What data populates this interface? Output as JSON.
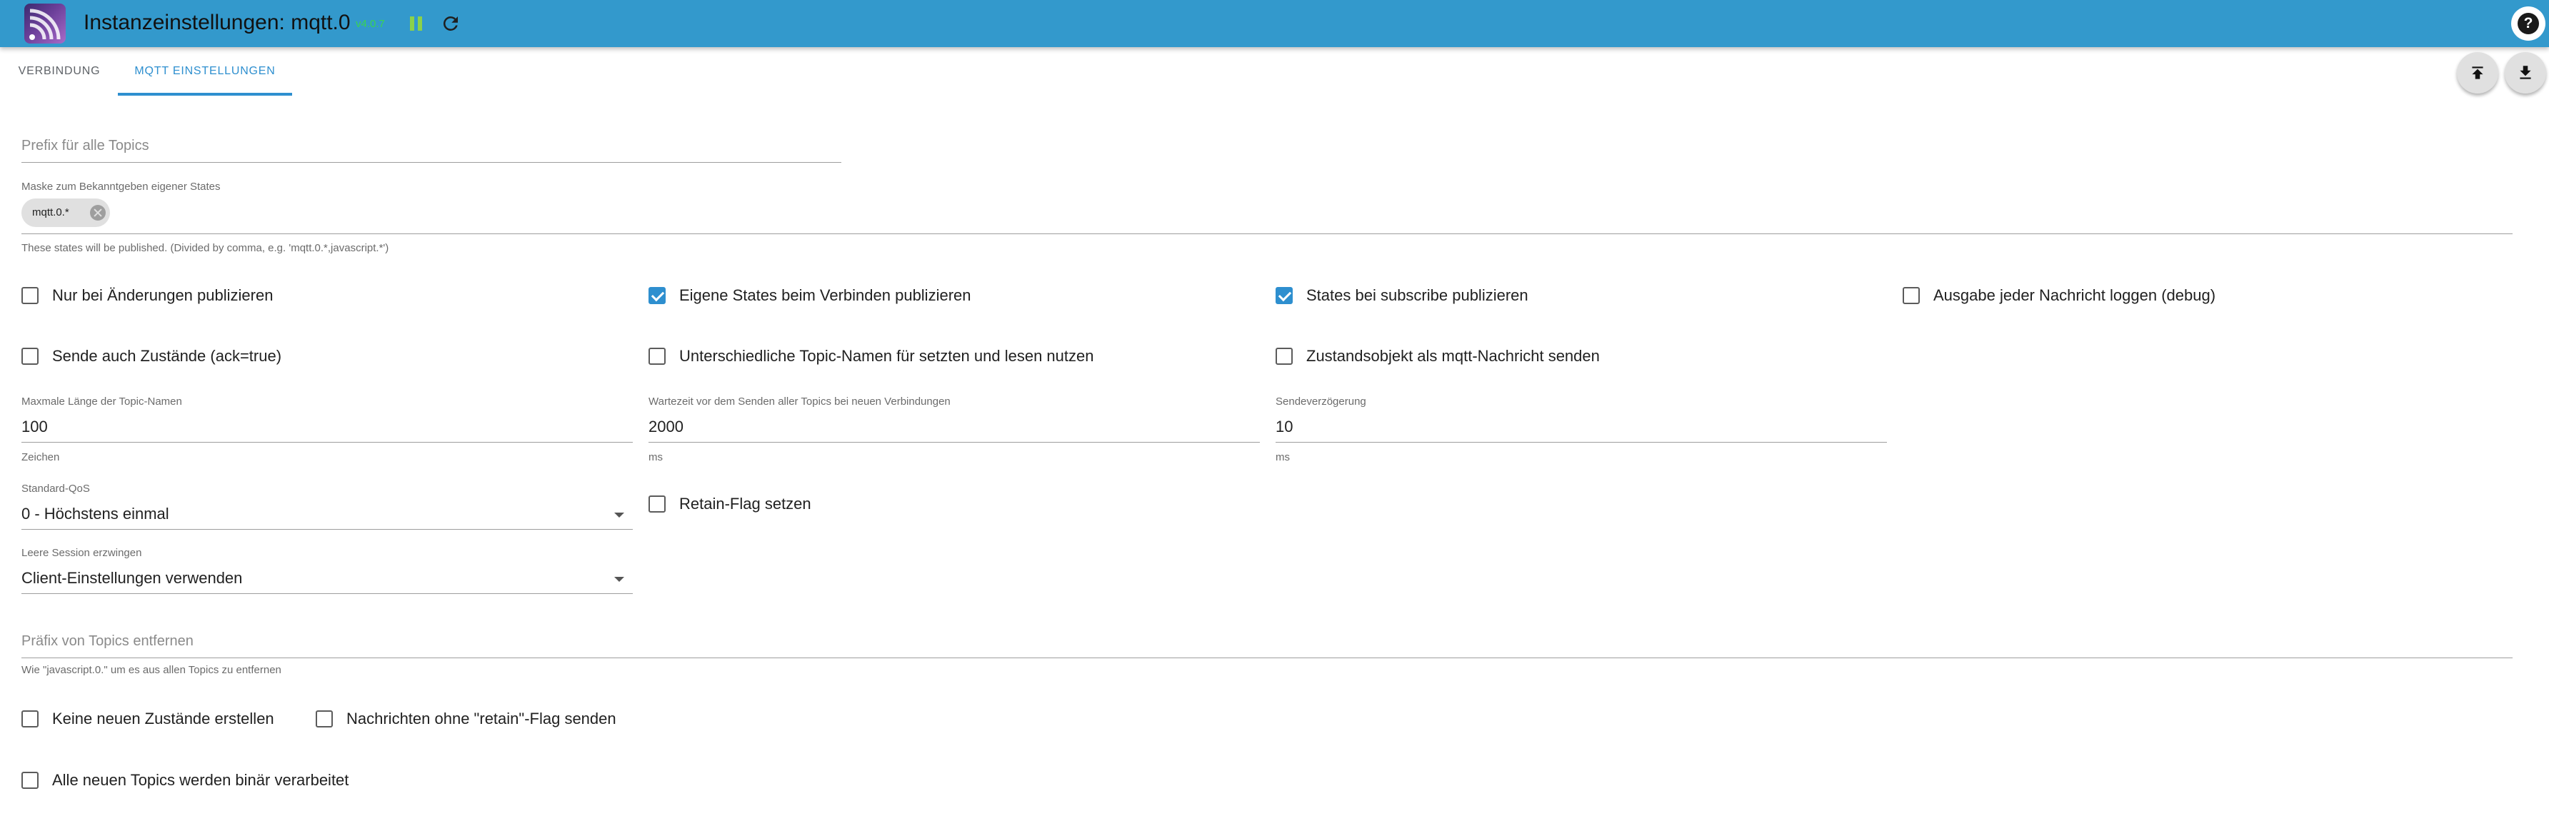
{
  "header": {
    "title": "Instanzeinstellungen: mqtt.0",
    "version": "v4.0.7",
    "help_label": "?"
  },
  "tabs": [
    {
      "label": "VERBINDUNG",
      "active": false
    },
    {
      "label": "MQTT EINSTELLUNGEN",
      "active": true
    }
  ],
  "colors": {
    "appbar": "#3399cc",
    "accent": "#2e8fcf",
    "version": "#39d353"
  },
  "form": {
    "prefix": {
      "placeholder": "Prefix für alle Topics",
      "value": ""
    },
    "mask": {
      "label": "Maske zum Bekanntgeben eigener States",
      "chip": "mqtt.0.*",
      "helper": "These states will be published. (Divided by comma, e.g. 'mqtt.0.*,javascript.*')"
    },
    "checkboxes_row1": [
      {
        "label": "Nur bei Änderungen publizieren",
        "checked": false
      },
      {
        "label": "Eigene States beim Verbinden publizieren",
        "checked": true
      },
      {
        "label": "States bei subscribe publizieren",
        "checked": true
      },
      {
        "label": "Ausgabe jeder Nachricht loggen (debug)",
        "checked": false
      }
    ],
    "checkboxes_row2": [
      {
        "label": "Sende auch Zustände (ack=true)",
        "checked": false
      },
      {
        "label": "Unterschiedliche Topic-Namen für setzten und lesen nutzen",
        "checked": false
      },
      {
        "label": "Zustandsobjekt als mqtt-Nachricht senden",
        "checked": false
      }
    ],
    "max_topic_length": {
      "label": "Maxmale Länge der Topic-Namen",
      "value": "100",
      "helper": "Zeichen"
    },
    "wait_time": {
      "label": "Wartezeit vor dem Senden aller Topics bei neuen Verbindungen",
      "value": "2000",
      "helper": "ms"
    },
    "send_delay": {
      "label": "Sendeverzögerung",
      "value": "10",
      "helper": "ms"
    },
    "default_qos": {
      "label": "Standard-QoS",
      "value": "0 - Höchstens einmal"
    },
    "retain_flag": {
      "label": "Retain-Flag setzen",
      "checked": false
    },
    "clean_session": {
      "label": "Leere Session erzwingen",
      "value": "Client-Einstellungen verwenden"
    },
    "remove_prefix": {
      "placeholder": "Präfix von Topics entfernen",
      "helper": "Wie \"javascript.0.\" um es aus allen Topics zu entfernen"
    },
    "no_new_states": {
      "label": "Keine neuen Zustände erstellen",
      "checked": false
    },
    "no_retain": {
      "label": "Nachrichten ohne \"retain\"-Flag senden",
      "checked": false
    },
    "binary_topics": {
      "label": "Alle neuen Topics werden binär verarbeitet",
      "checked": false
    }
  }
}
